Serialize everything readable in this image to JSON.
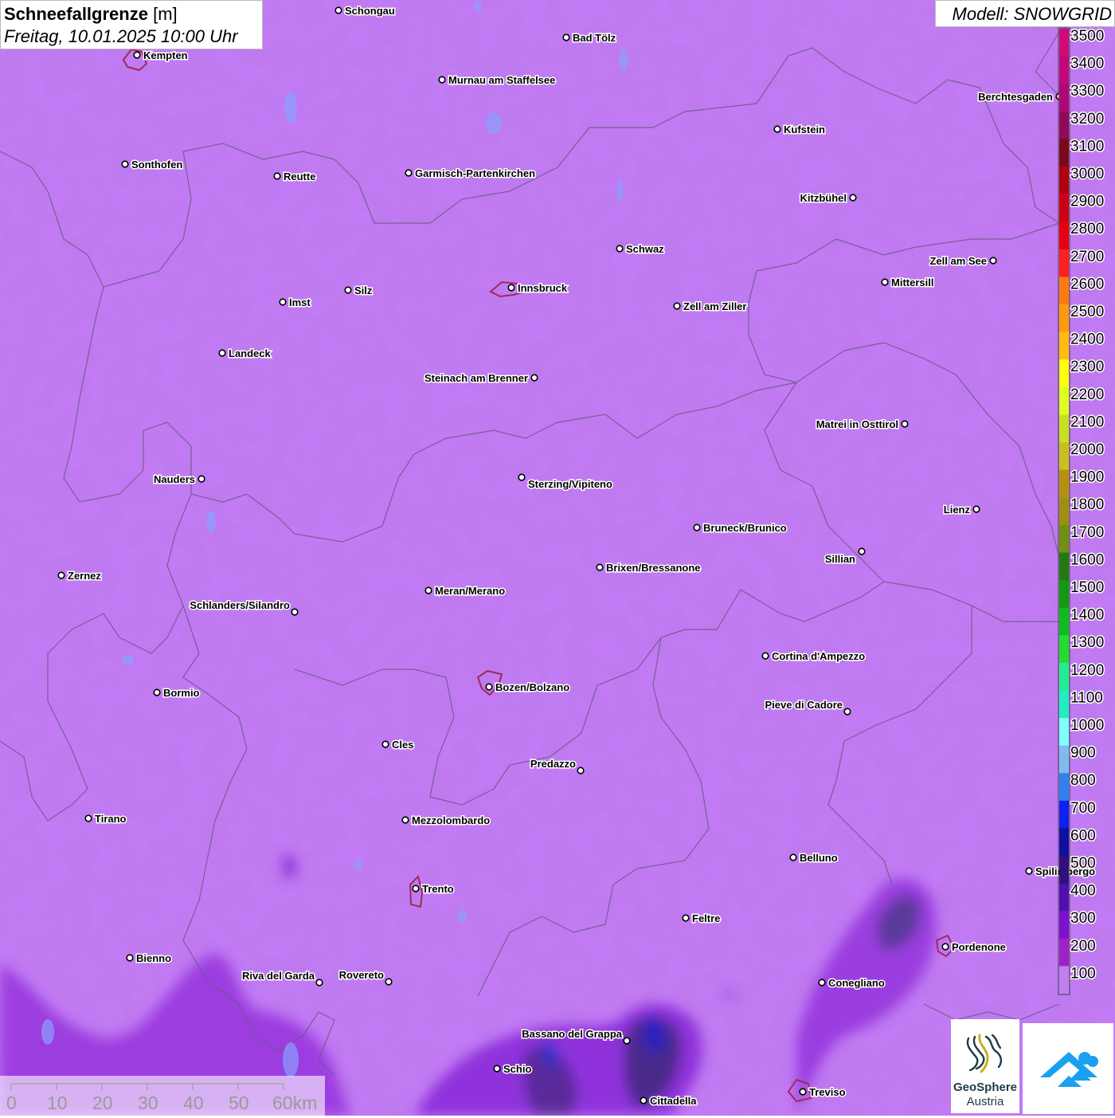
{
  "title": {
    "parameter": "Schneefallgrenze",
    "unit": "[m]",
    "datetime": "Freitag, 10.01.2025 10:00 Uhr"
  },
  "model": "Modell: SNOWGRID",
  "legend": [
    {
      "label": "3500",
      "color": "#d10a7a"
    },
    {
      "label": "3400",
      "color": "#c3077a"
    },
    {
      "label": "3300",
      "color": "#b0067a"
    },
    {
      "label": "3200",
      "color": "#8f0a5c"
    },
    {
      "label": "3100",
      "color": "#7a0a1a"
    },
    {
      "label": "3000",
      "color": "#b00010"
    },
    {
      "label": "2900",
      "color": "#cc0015"
    },
    {
      "label": "2800",
      "color": "#e60010"
    },
    {
      "label": "2700",
      "color": "#ff2020"
    },
    {
      "label": "2600",
      "color": "#ff7a10"
    },
    {
      "label": "2500",
      "color": "#ff9a10"
    },
    {
      "label": "2400",
      "color": "#ffbb10"
    },
    {
      "label": "2300",
      "color": "#ffff10"
    },
    {
      "label": "2200",
      "color": "#ddff20"
    },
    {
      "label": "2100",
      "color": "#c8e020"
    },
    {
      "label": "2000",
      "color": "#c8c020"
    },
    {
      "label": "1900",
      "color": "#b89010"
    },
    {
      "label": "1800",
      "color": "#a09010"
    },
    {
      "label": "1700",
      "color": "#709010"
    },
    {
      "label": "1600",
      "color": "#207a10"
    },
    {
      "label": "1500",
      "color": "#109a10"
    },
    {
      "label": "1400",
      "color": "#10bb20"
    },
    {
      "label": "1300",
      "color": "#20dd30"
    },
    {
      "label": "1200",
      "color": "#20ee90"
    },
    {
      "label": "1100",
      "color": "#20eec0"
    },
    {
      "label": "1000",
      "color": "#80ffff"
    },
    {
      "label": "900",
      "color": "#80bbee"
    },
    {
      "label": "800",
      "color": "#3080ee"
    },
    {
      "label": "700",
      "color": "#1020ee"
    },
    {
      "label": "600",
      "color": "#1010a0"
    },
    {
      "label": "500",
      "color": "#30107a"
    },
    {
      "label": "400",
      "color": "#5010b0"
    },
    {
      "label": "300",
      "color": "#8010d0"
    },
    {
      "label": "200",
      "color": "#a020c8"
    },
    {
      "label": "100",
      "color": "#c080f0"
    }
  ],
  "cities": [
    {
      "name": "Schongau"
    },
    {
      "name": "Bad Tölz"
    },
    {
      "name": "Kempten"
    },
    {
      "name": "Murnau am Staffelsee"
    },
    {
      "name": "Berchtesgaden"
    },
    {
      "name": "Kufstein"
    },
    {
      "name": "Sonthofen"
    },
    {
      "name": "Reutte"
    },
    {
      "name": "Garmisch-Partenkirchen"
    },
    {
      "name": "Kitzbühel"
    },
    {
      "name": "Schwaz"
    },
    {
      "name": "Zell am See"
    },
    {
      "name": "Innsbruck"
    },
    {
      "name": "Mittersill"
    },
    {
      "name": "Imst"
    },
    {
      "name": "Silz"
    },
    {
      "name": "Zell am Ziller"
    },
    {
      "name": "Landeck"
    },
    {
      "name": "Steinach am Brenner"
    },
    {
      "name": "Matrei in Osttirol"
    },
    {
      "name": "Nauders"
    },
    {
      "name": "Sterzing/Vipiteno"
    },
    {
      "name": "Lienz"
    },
    {
      "name": "Bruneck/Brunico"
    },
    {
      "name": "Sillian"
    },
    {
      "name": "Zernez"
    },
    {
      "name": "Brixen/Bressanone"
    },
    {
      "name": "Meran/Merano"
    },
    {
      "name": "Schlanders/Silandro"
    },
    {
      "name": "Cortina d'Ampezzo"
    },
    {
      "name": "Bozen/Bolzano"
    },
    {
      "name": "Bormio"
    },
    {
      "name": "Pieve di Cadore"
    },
    {
      "name": "Cles"
    },
    {
      "name": "Predazzo"
    },
    {
      "name": "Tirano"
    },
    {
      "name": "Mezzolombardo"
    },
    {
      "name": "Belluno"
    },
    {
      "name": "Spilimbergo"
    },
    {
      "name": "Trento"
    },
    {
      "name": "Feltre"
    },
    {
      "name": "Pordenone"
    },
    {
      "name": "Bienno"
    },
    {
      "name": "Riva del Garda"
    },
    {
      "name": "Rovereto"
    },
    {
      "name": "Conegliano"
    },
    {
      "name": "Bassano del Grappa"
    },
    {
      "name": "Schio"
    },
    {
      "name": "Treviso"
    },
    {
      "name": "Cittadella"
    }
  ],
  "scalebar": {
    "ticks": [
      "0",
      "10",
      "20",
      "30",
      "40",
      "50",
      "60km"
    ]
  },
  "logos": {
    "geosphere_line1": "GeoSphere",
    "geosphere_line2": "Austria"
  },
  "colors": {
    "background": "#c47cf7",
    "border": "#6a5a86",
    "city_outline": "#a02a5a"
  }
}
